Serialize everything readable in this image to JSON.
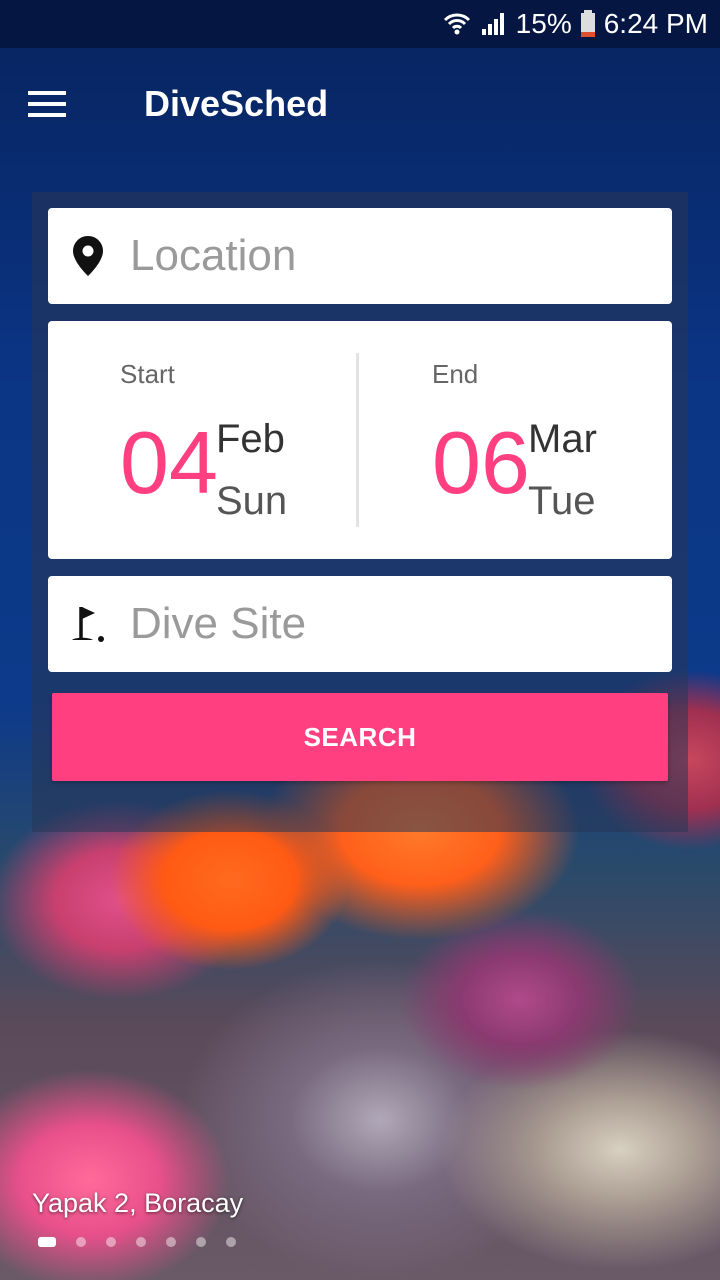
{
  "status_bar": {
    "battery": "15%",
    "time": "6:24 PM"
  },
  "app_bar": {
    "title": "DiveSched"
  },
  "search": {
    "location_placeholder": "Location",
    "dive_site_placeholder": "Dive Site",
    "start": {
      "label": "Start",
      "day": "04",
      "month": "Feb",
      "weekday": "Sun"
    },
    "end": {
      "label": "End",
      "day": "06",
      "month": "Mar",
      "weekday": "Tue"
    },
    "button_label": "SEARCH"
  },
  "carousel": {
    "caption": "Yapak 2, Boracay",
    "pages": 7,
    "active_index": 0
  },
  "colors": {
    "accent": "#ff3f7f",
    "panel": "#283755"
  },
  "icons": [
    "wifi-icon",
    "signal-icon",
    "battery-icon",
    "menu-icon",
    "location-pin-icon",
    "flag-icon"
  ]
}
